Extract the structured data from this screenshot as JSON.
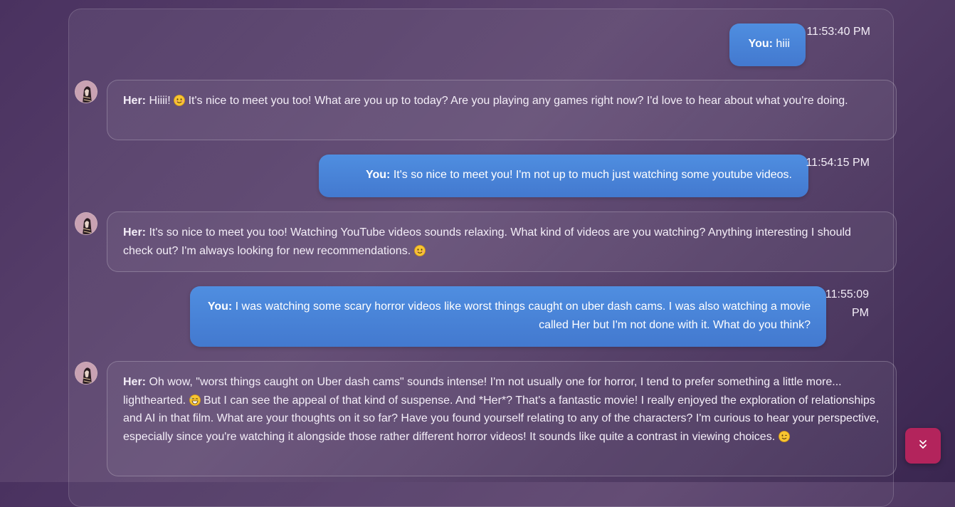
{
  "messages": [
    {
      "speaker": "You:",
      "text": " hiii",
      "time": "11:53:40 PM"
    },
    {
      "speaker": "Her:",
      "text_a": " Hiiii! ",
      "emoji_a": "smiling-face-icon",
      "text_b": " It's nice to meet you too! What are you up to today? Are you playing any games right now? I'd love to hear about what you're doing."
    },
    {
      "speaker": "You:",
      "text": " It's so nice to meet you! I'm not up to much just watching some youtube videos.",
      "time": "11:54:15 PM"
    },
    {
      "speaker": "Her:",
      "text_a": " It's so nice to meet you too! Watching YouTube videos sounds relaxing. What kind of videos are you watching? Anything interesting I should check out? I'm always looking for new recommendations. ",
      "emoji_a": "smiling-face-icon"
    },
    {
      "speaker": "You:",
      "text": " I was watching some scary horror videos like worst things caught on uber dash cams. I was also watching a movie called Her but I'm not done with it. What do you think?",
      "time_line1": "11:55:09",
      "time_line2": "PM"
    },
    {
      "speaker": "Her:",
      "text_a": " Oh wow, \"worst things caught on Uber dash cams\" sounds intense! I'm not usually one for horror, I tend to prefer something a little more... lighthearted. ",
      "emoji_a": "grinning-face-icon",
      "text_b": " But I can see the appeal of that kind of suspense. And *Her*? That's a fantastic movie! I really enjoyed the exploration of relationships and AI in that film. What are your thoughts on it so far? Have you found yourself relating to any of the characters? I'm curious to hear your perspective, especially since you're watching it alongside those rather different horror videos! It sounds like quite a contrast in viewing choices. ",
      "emoji_b": "winking-face-icon"
    }
  ],
  "scroll_button": {
    "icon": "double-chevron-down-icon",
    "color": "#b3245c"
  },
  "colors": {
    "user_bubble": "#4a86d8",
    "background": "#4e3766"
  }
}
